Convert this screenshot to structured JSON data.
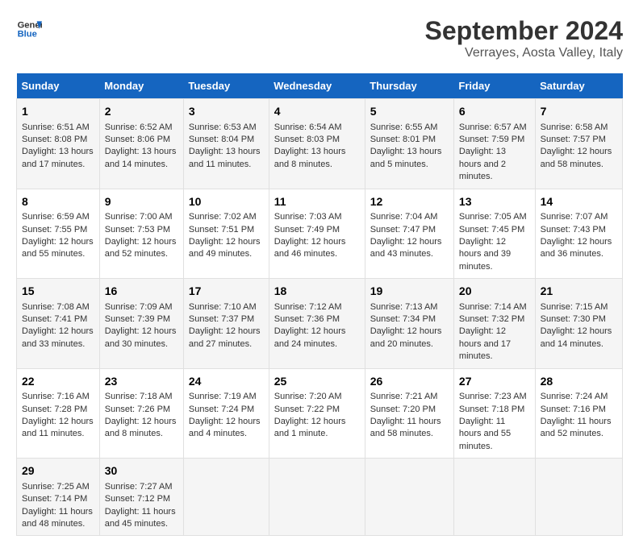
{
  "header": {
    "logo_line1": "General",
    "logo_line2": "Blue",
    "main_title": "September 2024",
    "subtitle": "Verrayes, Aosta Valley, Italy"
  },
  "calendar": {
    "days_of_week": [
      "Sunday",
      "Monday",
      "Tuesday",
      "Wednesday",
      "Thursday",
      "Friday",
      "Saturday"
    ],
    "weeks": [
      [
        null,
        null,
        null,
        null,
        null,
        null,
        null
      ]
    ],
    "cells": [
      {
        "day": "1",
        "col": 0,
        "content": "Sunrise: 6:51 AM\nSunset: 8:08 PM\nDaylight: 13 hours and 17 minutes."
      },
      {
        "day": "2",
        "col": 1,
        "content": "Sunrise: 6:52 AM\nSunset: 8:06 PM\nDaylight: 13 hours and 14 minutes."
      },
      {
        "day": "3",
        "col": 2,
        "content": "Sunrise: 6:53 AM\nSunset: 8:04 PM\nDaylight: 13 hours and 11 minutes."
      },
      {
        "day": "4",
        "col": 3,
        "content": "Sunrise: 6:54 AM\nSunset: 8:03 PM\nDaylight: 13 hours and 8 minutes."
      },
      {
        "day": "5",
        "col": 4,
        "content": "Sunrise: 6:55 AM\nSunset: 8:01 PM\nDaylight: 13 hours and 5 minutes."
      },
      {
        "day": "6",
        "col": 5,
        "content": "Sunrise: 6:57 AM\nSunset: 7:59 PM\nDaylight: 13 hours and 2 minutes."
      },
      {
        "day": "7",
        "col": 6,
        "content": "Sunrise: 6:58 AM\nSunset: 7:57 PM\nDaylight: 12 hours and 58 minutes."
      },
      {
        "day": "8",
        "col": 0,
        "content": "Sunrise: 6:59 AM\nSunset: 7:55 PM\nDaylight: 12 hours and 55 minutes."
      },
      {
        "day": "9",
        "col": 1,
        "content": "Sunrise: 7:00 AM\nSunset: 7:53 PM\nDaylight: 12 hours and 52 minutes."
      },
      {
        "day": "10",
        "col": 2,
        "content": "Sunrise: 7:02 AM\nSunset: 7:51 PM\nDaylight: 12 hours and 49 minutes."
      },
      {
        "day": "11",
        "col": 3,
        "content": "Sunrise: 7:03 AM\nSunset: 7:49 PM\nDaylight: 12 hours and 46 minutes."
      },
      {
        "day": "12",
        "col": 4,
        "content": "Sunrise: 7:04 AM\nSunset: 7:47 PM\nDaylight: 12 hours and 43 minutes."
      },
      {
        "day": "13",
        "col": 5,
        "content": "Sunrise: 7:05 AM\nSunset: 7:45 PM\nDaylight: 12 hours and 39 minutes."
      },
      {
        "day": "14",
        "col": 6,
        "content": "Sunrise: 7:07 AM\nSunset: 7:43 PM\nDaylight: 12 hours and 36 minutes."
      },
      {
        "day": "15",
        "col": 0,
        "content": "Sunrise: 7:08 AM\nSunset: 7:41 PM\nDaylight: 12 hours and 33 minutes."
      },
      {
        "day": "16",
        "col": 1,
        "content": "Sunrise: 7:09 AM\nSunset: 7:39 PM\nDaylight: 12 hours and 30 minutes."
      },
      {
        "day": "17",
        "col": 2,
        "content": "Sunrise: 7:10 AM\nSunset: 7:37 PM\nDaylight: 12 hours and 27 minutes."
      },
      {
        "day": "18",
        "col": 3,
        "content": "Sunrise: 7:12 AM\nSunset: 7:36 PM\nDaylight: 12 hours and 24 minutes."
      },
      {
        "day": "19",
        "col": 4,
        "content": "Sunrise: 7:13 AM\nSunset: 7:34 PM\nDaylight: 12 hours and 20 minutes."
      },
      {
        "day": "20",
        "col": 5,
        "content": "Sunrise: 7:14 AM\nSunset: 7:32 PM\nDaylight: 12 hours and 17 minutes."
      },
      {
        "day": "21",
        "col": 6,
        "content": "Sunrise: 7:15 AM\nSunset: 7:30 PM\nDaylight: 12 hours and 14 minutes."
      },
      {
        "day": "22",
        "col": 0,
        "content": "Sunrise: 7:16 AM\nSunset: 7:28 PM\nDaylight: 12 hours and 11 minutes."
      },
      {
        "day": "23",
        "col": 1,
        "content": "Sunrise: 7:18 AM\nSunset: 7:26 PM\nDaylight: 12 hours and 8 minutes."
      },
      {
        "day": "24",
        "col": 2,
        "content": "Sunrise: 7:19 AM\nSunset: 7:24 PM\nDaylight: 12 hours and 4 minutes."
      },
      {
        "day": "25",
        "col": 3,
        "content": "Sunrise: 7:20 AM\nSunset: 7:22 PM\nDaylight: 12 hours and 1 minute."
      },
      {
        "day": "26",
        "col": 4,
        "content": "Sunrise: 7:21 AM\nSunset: 7:20 PM\nDaylight: 11 hours and 58 minutes."
      },
      {
        "day": "27",
        "col": 5,
        "content": "Sunrise: 7:23 AM\nSunset: 7:18 PM\nDaylight: 11 hours and 55 minutes."
      },
      {
        "day": "28",
        "col": 6,
        "content": "Sunrise: 7:24 AM\nSunset: 7:16 PM\nDaylight: 11 hours and 52 minutes."
      },
      {
        "day": "29",
        "col": 0,
        "content": "Sunrise: 7:25 AM\nSunset: 7:14 PM\nDaylight: 11 hours and 48 minutes."
      },
      {
        "day": "30",
        "col": 1,
        "content": "Sunrise: 7:27 AM\nSunset: 7:12 PM\nDaylight: 11 hours and 45 minutes."
      }
    ]
  }
}
